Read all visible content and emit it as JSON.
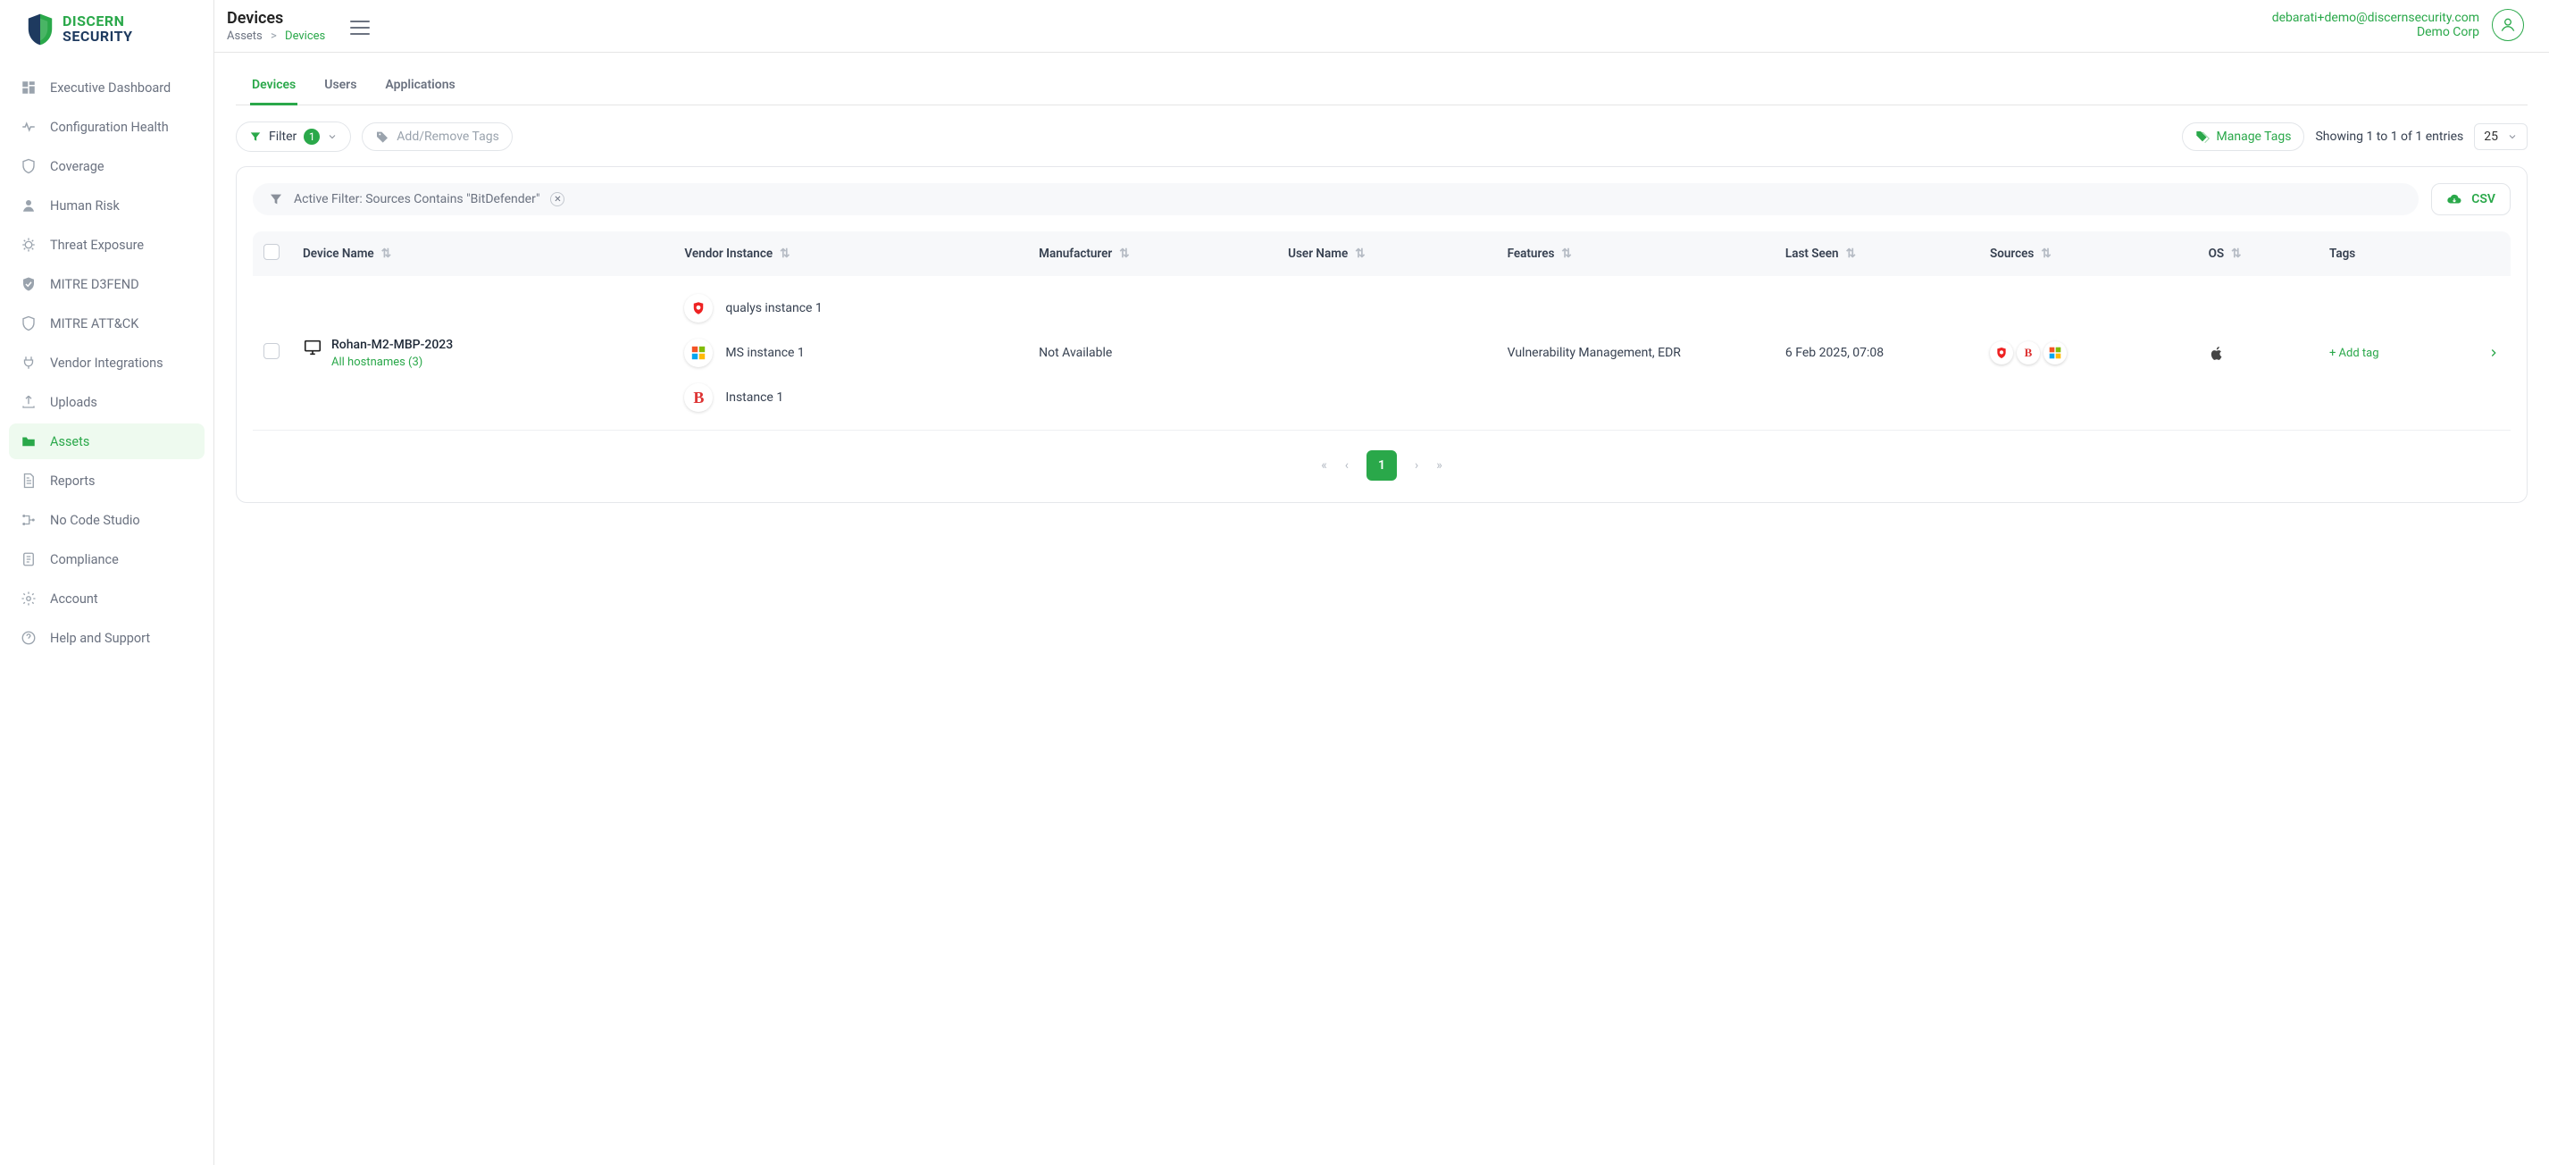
{
  "brand": {
    "line1": "DISCERN",
    "line2": "SECURITY"
  },
  "header": {
    "title": "Devices",
    "breadcrumb": {
      "root": "Assets",
      "current": "Devices"
    },
    "user_email": "debarati+demo@discernsecurity.com",
    "org": "Demo Corp"
  },
  "sidebar": {
    "items": [
      {
        "label": "Executive Dashboard",
        "icon": "dashboard-icon"
      },
      {
        "label": "Configuration Health",
        "icon": "heartbeat-icon"
      },
      {
        "label": "Coverage",
        "icon": "shield-icon"
      },
      {
        "label": "Human Risk",
        "icon": "user-icon"
      },
      {
        "label": "Threat Exposure",
        "icon": "bug-icon"
      },
      {
        "label": "MITRE D3FEND",
        "icon": "shield-check-icon"
      },
      {
        "label": "MITRE ATT&CK",
        "icon": "shield-x-icon"
      },
      {
        "label": "Vendor Integrations",
        "icon": "plug-icon"
      },
      {
        "label": "Uploads",
        "icon": "upload-icon"
      },
      {
        "label": "Assets",
        "icon": "folder-icon",
        "active": true
      },
      {
        "label": "Reports",
        "icon": "document-icon"
      },
      {
        "label": "No Code Studio",
        "icon": "flow-icon"
      },
      {
        "label": "Compliance",
        "icon": "note-icon"
      },
      {
        "label": "Account",
        "icon": "gear-icon"
      },
      {
        "label": "Help and Support",
        "icon": "help-icon"
      }
    ]
  },
  "tabs": [
    {
      "label": "Devices",
      "active": true
    },
    {
      "label": "Users"
    },
    {
      "label": "Applications"
    }
  ],
  "toolbar": {
    "filter_label": "Filter",
    "filter_count": "1",
    "tags_btn": "Add/Remove Tags",
    "manage_tags": "Manage Tags",
    "entries_text": "Showing 1 to 1 of 1 entries",
    "page_size": "25"
  },
  "active_filter": {
    "text": "Active Filter: Sources Contains \"BitDefender\""
  },
  "csv_label": "CSV",
  "columns": {
    "device": "Device Name",
    "vendor": "Vendor Instance",
    "manufacturer": "Manufacturer",
    "user": "User Name",
    "features": "Features",
    "last_seen": "Last Seen",
    "sources": "Sources",
    "os": "OS",
    "tags": "Tags"
  },
  "rows": [
    {
      "device_name": "Rohan-M2-MBP-2023",
      "hostnames_link": "All hostnames (3)",
      "vendors": [
        {
          "badge": "Q",
          "badge_color": "#d33",
          "label": "qualys instance 1"
        },
        {
          "badge": "MS",
          "badge_color": "ms",
          "label": "MS instance 1"
        },
        {
          "badge": "B",
          "badge_color": "#d33",
          "label": "Instance 1"
        }
      ],
      "manufacturer": "Not Available",
      "user_name": "",
      "features": "Vulnerability Management, EDR",
      "last_seen": "6 Feb 2025, 07:08",
      "sources": [
        "Q",
        "B",
        "MS"
      ],
      "os": "apple",
      "add_tag": "+ Add tag"
    }
  ],
  "pagination": {
    "current": "1"
  }
}
